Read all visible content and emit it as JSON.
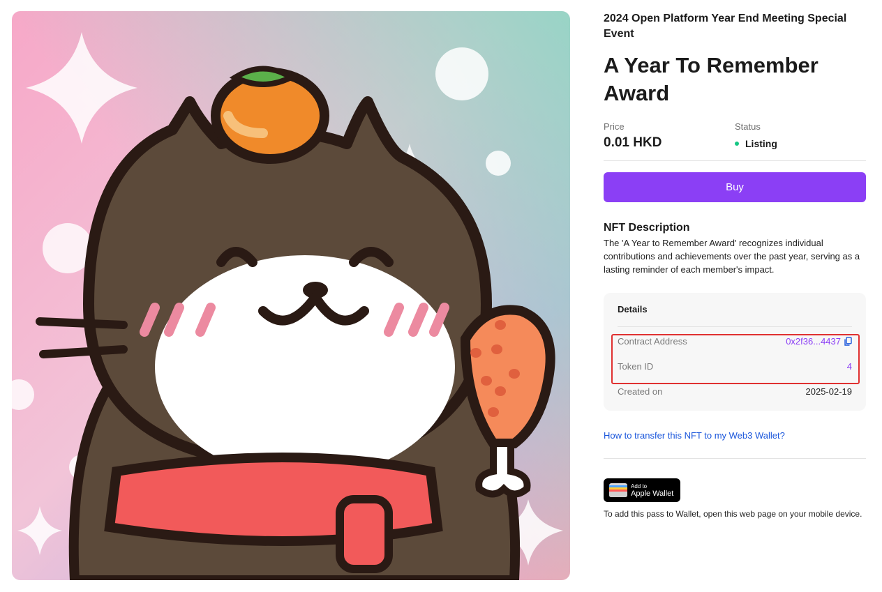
{
  "artwork": {
    "alt": "Cat holding a drumstick with a persimmon on its head"
  },
  "event_title": "2024 Open Platform Year End Meeting Special Event",
  "nft_title": "A Year To Remember Award",
  "price": {
    "label": "Price",
    "value": "0.01 HKD"
  },
  "status": {
    "label": "Status",
    "value": "Listing",
    "color": "#16c784"
  },
  "buy_button": {
    "label": "Buy",
    "color": "#8b3ff5"
  },
  "description": {
    "heading": "NFT Description",
    "text": "The 'A Year to Remember Award' recognizes individual contributions and achievements over the past year, serving as a lasting reminder of each member's impact."
  },
  "details": {
    "heading": "Details",
    "rows": [
      {
        "key": "Contract Address",
        "value": "0x2f36...4437",
        "icon": "copy-icon"
      },
      {
        "key": "Token ID",
        "value": "4"
      },
      {
        "key": "Created on",
        "value": "2025-02-19"
      }
    ]
  },
  "help_link": "How to transfer this NFT to my Web3 Wallet?",
  "wallet": {
    "small": "Add to",
    "big": "Apple Wallet",
    "note": "To add this pass to Wallet, open this web page on your mobile device."
  }
}
